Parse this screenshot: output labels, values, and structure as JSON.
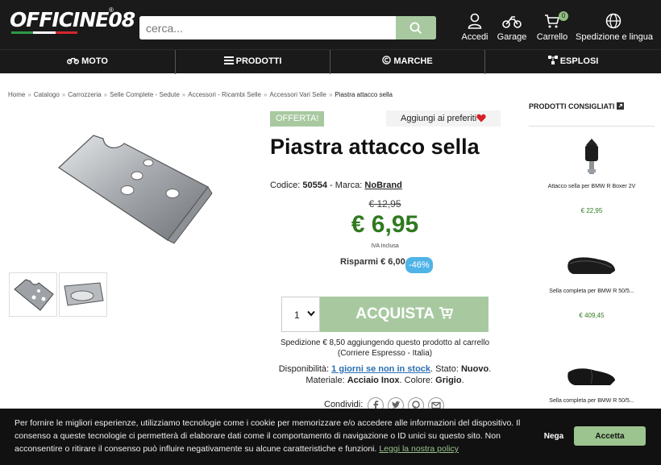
{
  "header": {
    "logo_text": "OFFICINE08",
    "logo_reg": "®",
    "search_placeholder": "cerca...",
    "accedi": "Accedi",
    "garage": "Garage",
    "carrello": "Carrello",
    "cart_count": "0",
    "spedizione": "Spedizione e lingua"
  },
  "nav": {
    "moto": "MOTO",
    "prodotti": "PRODOTTI",
    "marche": "MARCHE",
    "esplosi": "ESPLOSI"
  },
  "breadcrumb": [
    "Home",
    "Catalogo",
    "Carrozzeria",
    "Selle Complete - Sedute",
    "Accessori - Ricambi Selle",
    "Accessori Vari Selle",
    "Piastra attacco sella"
  ],
  "breadcrumb_sep": "»",
  "product": {
    "offer_badge": "OFFERTA!",
    "favorites": "Aggiungi ai preferiti",
    "title": "Piastra attacco sella",
    "code_label": "Codice:",
    "code": "50554",
    "brand_label": "- Marca:",
    "brand": "NoBrand",
    "old_price": "€ 12,95",
    "price": "€ 6,95",
    "iva": "IVA Inclusa",
    "save": "Risparmi € 6,00",
    "discount": "-46%",
    "qty": "1",
    "buy": "ACQUISTA",
    "shipping_line1": "Spedizione € 8,50 aggiungendo questo prodotto al carrello",
    "shipping_line2": "(Corriere Espresso - Italia)",
    "avail_label": "Disponibilità:",
    "avail_value": "1 giorni se non in stock",
    "stato_label": ". Stato:",
    "stato": "Nuovo",
    "material_label": "Materiale:",
    "material": "Acciaio Inox",
    "color_label": ". Colore:",
    "color": "Grigio",
    "share": "Condividi:"
  },
  "sidebar": {
    "title": "PRODOTTI CONSIGLIATI",
    "items": [
      {
        "name": "Attacco sella per BMW R Boxer 2V",
        "price": "€ 22,95"
      },
      {
        "name": "Sella completa per BMW R 50/5...",
        "price": "€ 409,45"
      },
      {
        "name": "Sella completa per BMW R 50/5...",
        "price": ""
      }
    ]
  },
  "cookie": {
    "text": "Per fornire le migliori esperienze, utilizziamo tecnologie come i cookie per memorizzare e/o accedere alle informazioni del dispositivo. Il consenso a queste tecnologie ci permetterà di elaborare dati come il comportamento di navigazione o ID unici su questo sito. Non acconsentire o ritirare il consenso può influire negativamente su alcune caratteristiche e funzioni.",
    "policy": "Leggi la nostra policy",
    "deny": "Nega",
    "accept": "Accetta"
  },
  "colors": {
    "accent_green": "#a8c9a0",
    "price_green": "#2f7a1f",
    "discount_blue": "#4fb3e8",
    "header_bg": "#1a1a1a"
  },
  "icons": [
    "search-icon",
    "user-icon",
    "motorcycle-icon",
    "cart-icon",
    "globe-icon",
    "list-icon",
    "copyright-icon",
    "diagram-icon",
    "heart-icon",
    "chevron-down-icon",
    "cart-plus-icon",
    "facebook-icon",
    "twitter-icon",
    "pinterest-icon",
    "mail-icon",
    "external-link-icon"
  ]
}
